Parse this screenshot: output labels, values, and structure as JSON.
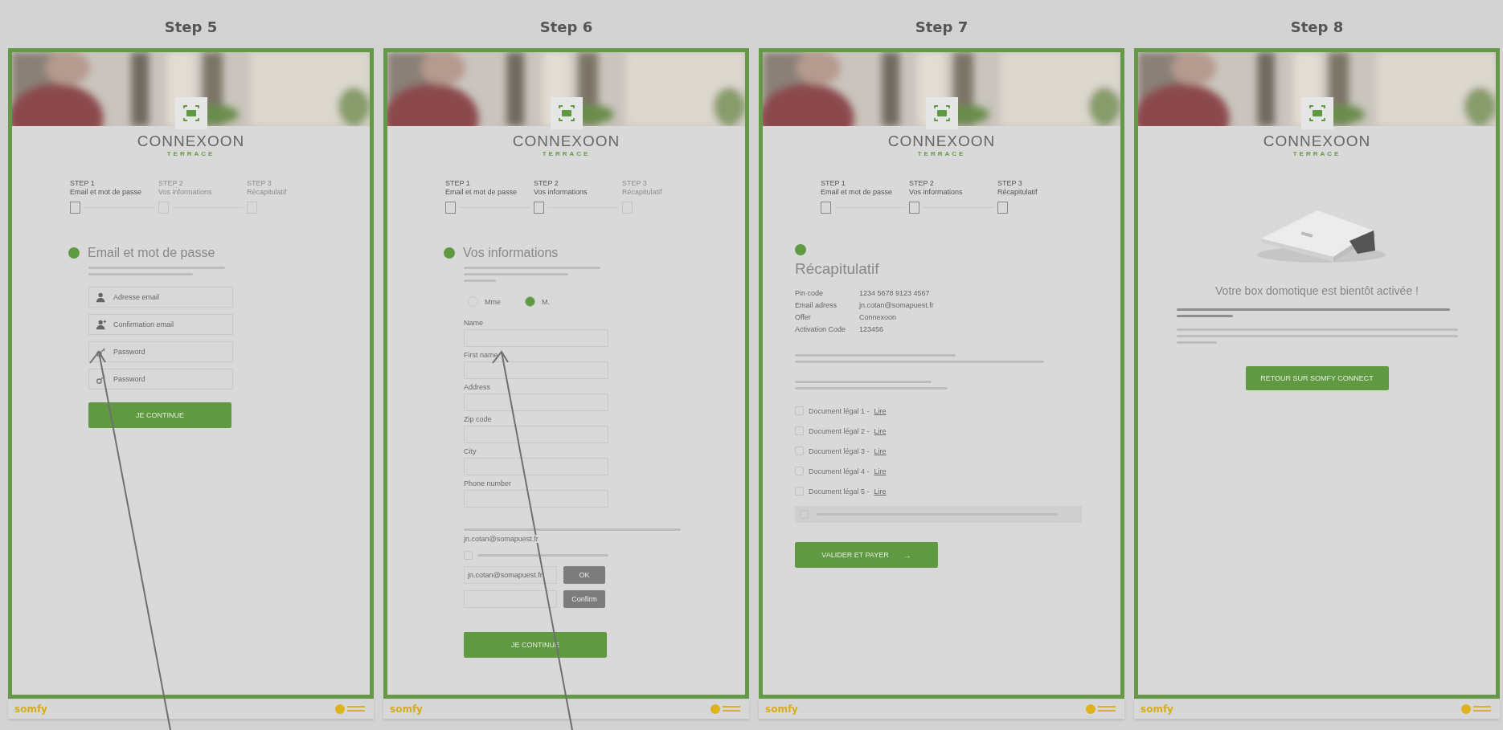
{
  "steps": [
    {
      "title": "Step 5",
      "kind": "email",
      "logo": "CONNEXOON",
      "logo_sub": "TERRACE",
      "stepper": [
        {
          "number": "STEP 1",
          "label": "Email et mot de passe",
          "active": true
        },
        {
          "number": "STEP 2",
          "label": "Vos informations",
          "active": false
        },
        {
          "number": "STEP 3",
          "label": "Récapitulatif",
          "active": false
        }
      ],
      "heading": "Email et mot de passe",
      "fields": [
        {
          "placeholder": "Adresse email"
        },
        {
          "placeholder": "Confirmation email"
        },
        {
          "placeholder": "Password"
        },
        {
          "placeholder": "Password"
        }
      ],
      "button": "JE CONTINUE",
      "footer_logo": "somfy"
    },
    {
      "title": "Step 6",
      "kind": "info",
      "logo": "CONNEXOON",
      "logo_sub": "TERRACE",
      "stepper": [
        {
          "number": "STEP 1",
          "label": "Email et mot de passe",
          "active": true
        },
        {
          "number": "STEP 2",
          "label": "Vos informations",
          "active": true
        },
        {
          "number": "STEP 3",
          "label": "Récapitulatif",
          "active": false
        }
      ],
      "heading": "Vos informations",
      "radios": [
        {
          "label": "Mme",
          "selected": false
        },
        {
          "label": "M.",
          "selected": true
        }
      ],
      "fields": [
        {
          "label": "Name"
        },
        {
          "label": "First name"
        },
        {
          "label": "Address"
        },
        {
          "label": "Zip code"
        },
        {
          "label": "City"
        },
        {
          "label": "Phone number"
        }
      ],
      "email_note": "jn.cotan@somapuest.fr",
      "consent_checked": false,
      "email_rows": [
        {
          "value": "jn.cotan@somapuest.fr",
          "button": "OK"
        },
        {
          "button": "Confirm"
        }
      ],
      "button": "JE CONTINUE",
      "footer_logo": "somfy"
    },
    {
      "title": "Step 7",
      "kind": "summary",
      "logo": "CONNEXOON",
      "logo_sub": "TERRACE",
      "stepper": [
        {
          "number": "STEP 1",
          "label": "Email et mot de passe",
          "active": true
        },
        {
          "number": "STEP 2",
          "label": "Vos informations",
          "active": true
        },
        {
          "number": "STEP 3",
          "label": "Récapitulatif",
          "active": true
        }
      ],
      "heading": "Récapitulatif",
      "summary": [
        {
          "label": "Pin code",
          "value": "1234 5678 9123 4567"
        },
        {
          "label": "Email adress",
          "value": "jn.cotan@somapuest.fr"
        },
        {
          "label": "Offer",
          "value": "Connexoon"
        },
        {
          "label": "Activation Code",
          "value": "123456"
        }
      ],
      "documents": [
        {
          "label": "Document légal 1 -",
          "link": "Lire",
          "checked": false
        },
        {
          "label": "Document légal 2 -",
          "link": "Lire",
          "checked": false
        },
        {
          "label": "Document légal 3 -",
          "link": "Lire",
          "checked": false
        },
        {
          "label": "Document légal 4 -",
          "link": "Lire",
          "checked": false
        },
        {
          "label": "Document légal 5 -",
          "link": "Lire",
          "checked": false
        }
      ],
      "notice_checked": false,
      "button": "VALIDER ET PAYER",
      "button_icon": "→",
      "footer_logo": "somfy"
    },
    {
      "title": "Step 8",
      "kind": "done",
      "logo": "CONNEXOON",
      "logo_sub": "TERRACE",
      "heading": "Votre box domotique est bientôt activée !",
      "button": "RETOUR SUR SOMFY CONNECT",
      "footer_logo": "somfy"
    }
  ]
}
